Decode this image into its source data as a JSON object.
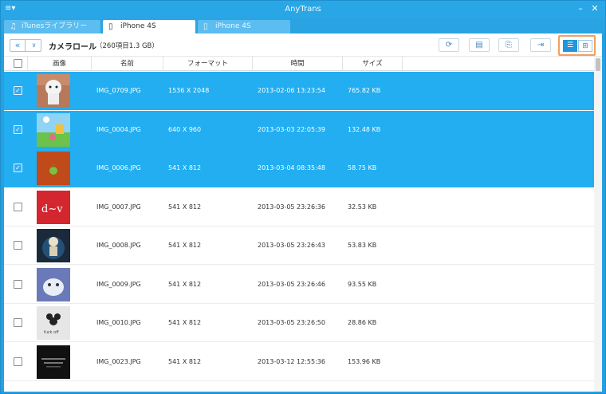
{
  "app": {
    "title": "AnyTrans"
  },
  "window_controls": {
    "menu": "≡▾",
    "minimize": "–",
    "close": "✕"
  },
  "tabs": [
    {
      "label": "iTunesライブラリー",
      "icon": "music-note-icon",
      "glyph": "♫",
      "active": false
    },
    {
      "label": "iPhone 4S",
      "icon": "phone-icon",
      "glyph": "▯",
      "active": true
    },
    {
      "label": "iPhone 4S",
      "icon": "phone-icon",
      "glyph": "▯",
      "active": false
    }
  ],
  "toolbar": {
    "back_glyph": "«",
    "dropdown_glyph": "∨",
    "breadcrumb": "カメラロール",
    "count": "（260項目1.3 GB）",
    "buttons": [
      {
        "icon": "refresh-icon",
        "glyph": "⟳"
      },
      {
        "icon": "delete-icon",
        "glyph": "▤"
      },
      {
        "icon": "transfer-to-computer-icon",
        "glyph": "⎘"
      },
      {
        "icon": "import-icon",
        "glyph": "⇥"
      }
    ],
    "view_list_glyph": "☰",
    "view_grid_glyph": "⊞"
  },
  "columns": [
    "画像",
    "名前",
    "フォーマット",
    "時間",
    "サイズ"
  ],
  "rows": [
    {
      "selected": true,
      "name": "IMG_0709.JPG",
      "format": "1536 X 2048",
      "time": "2013-02-06 13:23:54",
      "size": "765.82 KB",
      "thumb": "white-figure"
    },
    {
      "selected": true,
      "name": "IMG_0004.JPG",
      "format": "640 X 960",
      "time": "2013-03-03 22:05:39",
      "size": "132.48 KB",
      "thumb": "cartoon-field"
    },
    {
      "selected": true,
      "name": "IMG_0006.JPG",
      "format": "541 X 812",
      "time": "2013-03-04 08:35:48",
      "size": "58.75 KB",
      "thumb": "green-ball"
    },
    {
      "selected": false,
      "name": "IMG_0007.JPG",
      "format": "541 X 812",
      "time": "2013-03-05 23:26:36",
      "size": "32.53 KB",
      "thumb": "red-card"
    },
    {
      "selected": false,
      "name": "IMG_0008.JPG",
      "format": "541 X 812",
      "time": "2013-03-05 23:26:43",
      "size": "53.83 KB",
      "thumb": "dark-figure"
    },
    {
      "selected": false,
      "name": "IMG_0009.JPG",
      "format": "541 X 812",
      "time": "2013-03-05 23:26:46",
      "size": "93.55 KB",
      "thumb": "blue-monster"
    },
    {
      "selected": false,
      "name": "IMG_0010.JPG",
      "format": "541 X 812",
      "time": "2013-03-05 23:26:50",
      "size": "28.86 KB",
      "thumb": "mouse-sketch"
    },
    {
      "selected": false,
      "name": "IMG_0023.JPG",
      "format": "541 X 812",
      "time": "2013-03-12 12:55:36",
      "size": "153.96 KB",
      "thumb": "black-text"
    }
  ],
  "colors": {
    "accent": "#22aef0",
    "titlebar": "#29a6e6",
    "highlight_border": "#f0a060"
  }
}
